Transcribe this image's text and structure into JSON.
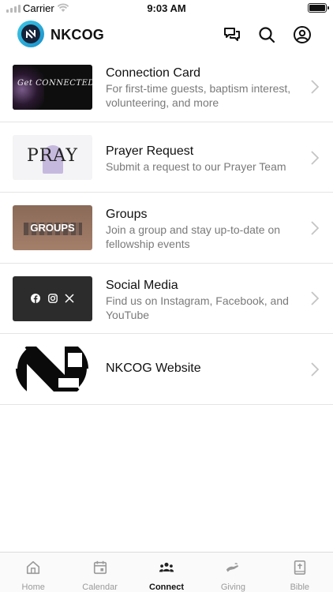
{
  "status_bar": {
    "carrier": "Carrier",
    "time": "9:03 AM"
  },
  "header": {
    "title": "NKCOG"
  },
  "items": [
    {
      "title": "Connection Card",
      "subtitle": "For first-time guests, baptism interest, volunteering, and more",
      "thumb_text": "Get CONNECTED"
    },
    {
      "title": "Prayer Request",
      "subtitle": "Submit a request to our Prayer Team",
      "thumb_text": "PRAY"
    },
    {
      "title": "Groups",
      "subtitle": "Join a group and stay up-to-date on fellowship events",
      "thumb_text": "GROUPS"
    },
    {
      "title": "Social Media",
      "subtitle": "Find us on Instagram, Facebook, and YouTube"
    },
    {
      "title": "NKCOG Website",
      "subtitle": ""
    }
  ],
  "tabs": [
    {
      "label": "Home",
      "icon": "home-icon"
    },
    {
      "label": "Calendar",
      "icon": "calendar-icon"
    },
    {
      "label": "Connect",
      "icon": "people-icon"
    },
    {
      "label": "Giving",
      "icon": "giving-hand-icon"
    },
    {
      "label": "Bible",
      "icon": "bible-icon"
    }
  ],
  "active_tab": "Connect"
}
